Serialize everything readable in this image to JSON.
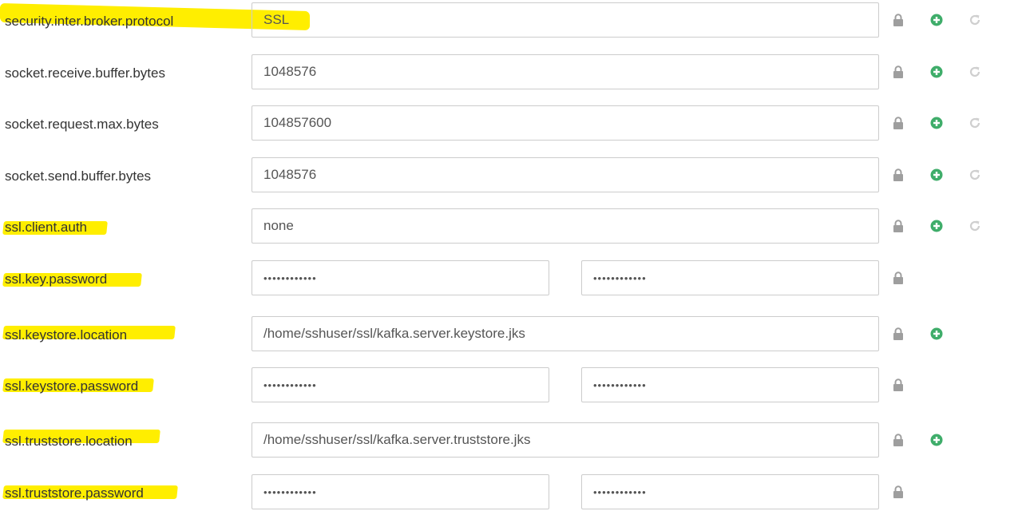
{
  "config_rows": [
    {
      "key": "security.inter.broker.protocol",
      "value": "SSL",
      "type": "text",
      "highlighted": true,
      "icons": [
        "lock-icon",
        "add-icon",
        "undo-icon"
      ]
    },
    {
      "key": "socket.receive.buffer.bytes",
      "value": "1048576",
      "type": "text",
      "highlighted": false,
      "icons": [
        "lock-icon",
        "add-icon",
        "undo-icon"
      ]
    },
    {
      "key": "socket.request.max.bytes",
      "value": "104857600",
      "type": "text",
      "highlighted": false,
      "icons": [
        "lock-icon",
        "add-icon",
        "undo-icon"
      ]
    },
    {
      "key": "socket.send.buffer.bytes",
      "value": "1048576",
      "type": "text",
      "highlighted": false,
      "icons": [
        "lock-icon",
        "add-icon",
        "undo-icon"
      ]
    },
    {
      "key": "ssl.client.auth",
      "value": "none",
      "type": "text",
      "highlighted": true,
      "icons": [
        "lock-icon",
        "add-icon",
        "undo-icon"
      ]
    },
    {
      "key": "ssl.key.password",
      "value": "••••••••••••",
      "confirm_value": "••••••••••••",
      "type": "password",
      "highlighted": true,
      "icons": [
        "lock-icon"
      ]
    },
    {
      "key": "ssl.keystore.location",
      "value": "/home/sshuser/ssl/kafka.server.keystore.jks",
      "type": "text",
      "highlighted": true,
      "icons": [
        "lock-icon",
        "add-icon"
      ]
    },
    {
      "key": "ssl.keystore.password",
      "value": "••••••••••••",
      "confirm_value": "••••••••••••",
      "type": "password",
      "highlighted": true,
      "icons": [
        "lock-icon"
      ]
    },
    {
      "key": "ssl.truststore.location",
      "value": "/home/sshuser/ssl/kafka.server.truststore.jks",
      "type": "text",
      "highlighted": true,
      "icons": [
        "lock-icon",
        "add-icon"
      ]
    },
    {
      "key": "ssl.truststore.password",
      "value": "••••••••••••",
      "confirm_value": "••••••••••••",
      "type": "password",
      "highlighted": true,
      "icons": [
        "lock-icon"
      ]
    }
  ],
  "colors": {
    "highlight": "#ffee00",
    "lock_icon": "#9e9e9e",
    "add_icon": "#3fad6a",
    "undo_icon": "#cfcfcf",
    "input_border": "#cccccc",
    "label_text": "#333333",
    "value_text": "#555555"
  }
}
